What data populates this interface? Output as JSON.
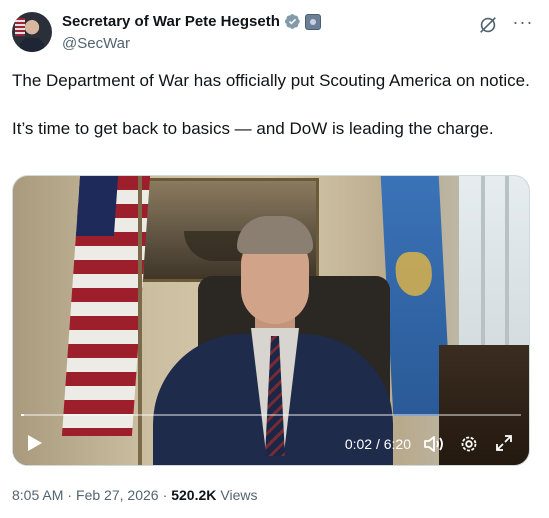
{
  "author": {
    "name": "Secretary of War Pete Hegseth",
    "handle": "@SecWar",
    "verified_color": "#829aab"
  },
  "actions": {
    "grok_icon": "grok-icon",
    "more_label": "···"
  },
  "tweet": {
    "paragraphs": [
      "The Department of War has officially put Scouting America on notice.",
      "It’s time to get back to basics — and DoW is leading the charge."
    ]
  },
  "video": {
    "time_display": "0:02 / 6:20",
    "progress": 0.005,
    "icons": [
      "play-icon",
      "volume-icon",
      "settings-icon",
      "fullscreen-icon"
    ]
  },
  "meta": {
    "time": "8:05 AM",
    "separator1": "·",
    "date": "Feb 27, 2026",
    "separator2": "·",
    "views_count": "520.2K",
    "views_label": "Views"
  }
}
